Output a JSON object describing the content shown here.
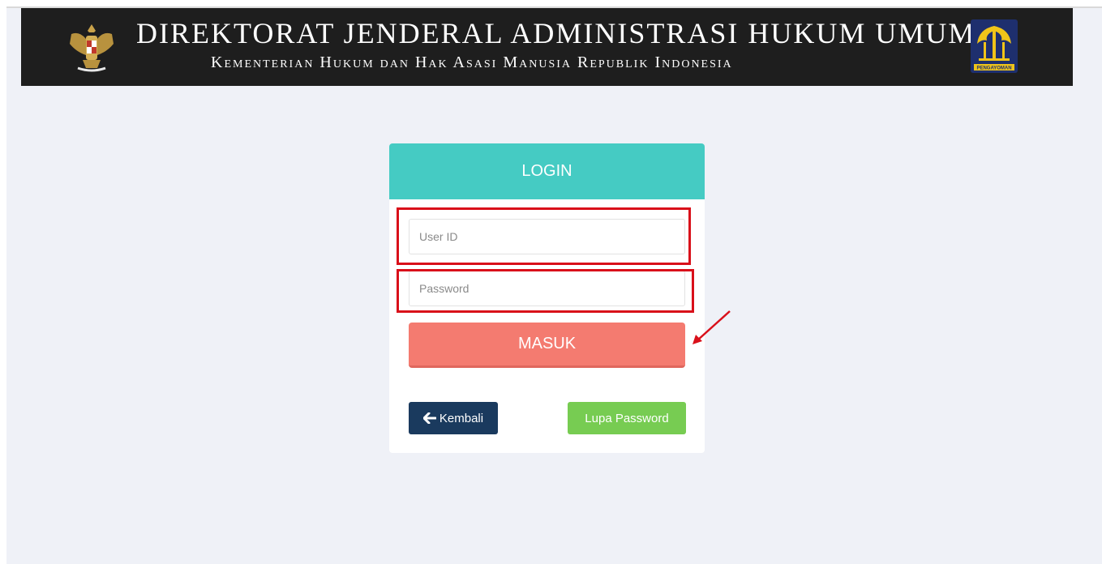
{
  "banner": {
    "title": "DIREKTORAT JENDERAL ADMINISTRASI HUKUM UMUM",
    "subtitle": "Kementerian Hukum dan Hak Asasi Manusia Republik Indonesia",
    "logo_right_text": "PENGAYOMAN"
  },
  "login": {
    "header": "LOGIN",
    "user_id_placeholder": "User ID",
    "password_placeholder": "Password",
    "submit_label": "MASUK",
    "back_label": "Kembali",
    "back_icon": "arrow-left-icon",
    "forgot_label": "Lupa Password"
  },
  "colors": {
    "header_bg": "#45cbc3",
    "submit_bg": "#f47b70",
    "back_bg": "#1a3a5e",
    "forgot_bg": "#77cc52",
    "highlight": "#d9101a"
  }
}
